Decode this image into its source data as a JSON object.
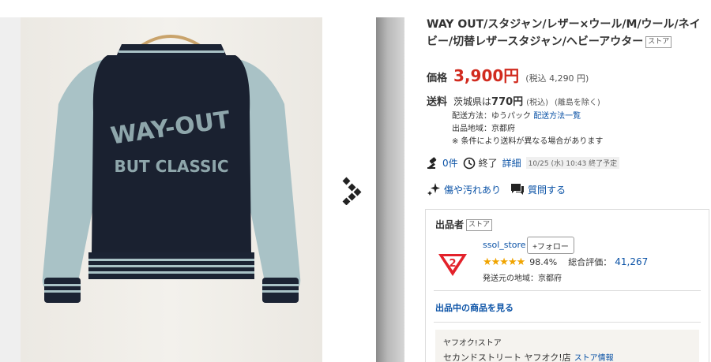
{
  "title": "WAY OUT/スタジャン/レザー×ウール/M/ウール/ネイビー/切替レザースタジャン/ヘビーアウター",
  "title_badge": "ストア",
  "price": {
    "label": "価格",
    "value": "3,900円",
    "tax": "(税込 4,290 円)"
  },
  "shipping": {
    "label": "送料",
    "prefecture": "茨城県は",
    "amount": "770円",
    "tax_note": "(税込)",
    "island_note": "(離島を除く)",
    "method_prefix": "配送方法：ゆうパック",
    "method_link": "配送方法一覧",
    "origin": "出品地域：京都府",
    "note": "※ 条件により送料が異なる場合があります"
  },
  "status": {
    "bids": "0件",
    "end_label": "終了",
    "detail_link": "詳細",
    "end_date": "10/25 (水) 10:43 終了予定"
  },
  "links": {
    "condition": "傷や汚れあり",
    "question": "質問する"
  },
  "seller": {
    "heading": "出品者",
    "badge": "ストア",
    "name": "ssol_store",
    "follow": "+フォロー",
    "stars": "★★★★★",
    "percent": "98.4%",
    "total_label": "総合評価：",
    "total_count": "41,267",
    "region": "発送元の地域：京都府",
    "see_items": "出品中の商品を見る",
    "shop_type": "ヤフオク!ストア",
    "shop_name": "セカンドストリート ヤフオク!店",
    "shop_info": "ストア情報",
    "logo_number": "2"
  },
  "jacket_text": {
    "line1": "WAY-OUT",
    "line2": "BUT CLASSIC"
  },
  "colors": {
    "price_red": "#d12b1f",
    "link_blue": "#0a52a6",
    "star_gold": "#f0a400",
    "logo_red": "#e3212a"
  }
}
